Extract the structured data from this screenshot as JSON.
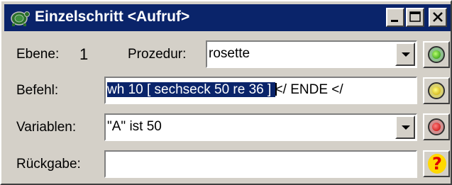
{
  "window": {
    "title": "Einzelschritt <Aufruf>",
    "icon": "turtle-icon",
    "controls": [
      "minimize-icon",
      "maximize-icon",
      "close-icon"
    ]
  },
  "ebene": {
    "label": "Ebene:",
    "value": "1"
  },
  "prozedur": {
    "label": "Prozedur:",
    "value": "rosette",
    "icon": "chevron-down-icon"
  },
  "befehl": {
    "label": "Befehl:",
    "selected_text": "wh 10 [ sechseck 50 re 36 ] ",
    "rest_text": "</ ENDE </"
  },
  "variablen": {
    "label": "Variablen:",
    "value": "\"A\" ist 50",
    "icon": "chevron-down-icon"
  },
  "rueckgabe": {
    "label": "Rückgabe:",
    "value": ""
  },
  "side_buttons": [
    {
      "icon": "green-light-icon",
      "color": "#1a8a00"
    },
    {
      "icon": "yellow-light-icon",
      "color": "#c8a000"
    },
    {
      "icon": "red-light-icon",
      "color": "#c00000"
    },
    {
      "icon": "help-icon",
      "color": "#ffd800"
    }
  ],
  "colors": {
    "titlebar": "#0a246a",
    "selection": "#0a246a",
    "face": "#d4d0c8"
  }
}
